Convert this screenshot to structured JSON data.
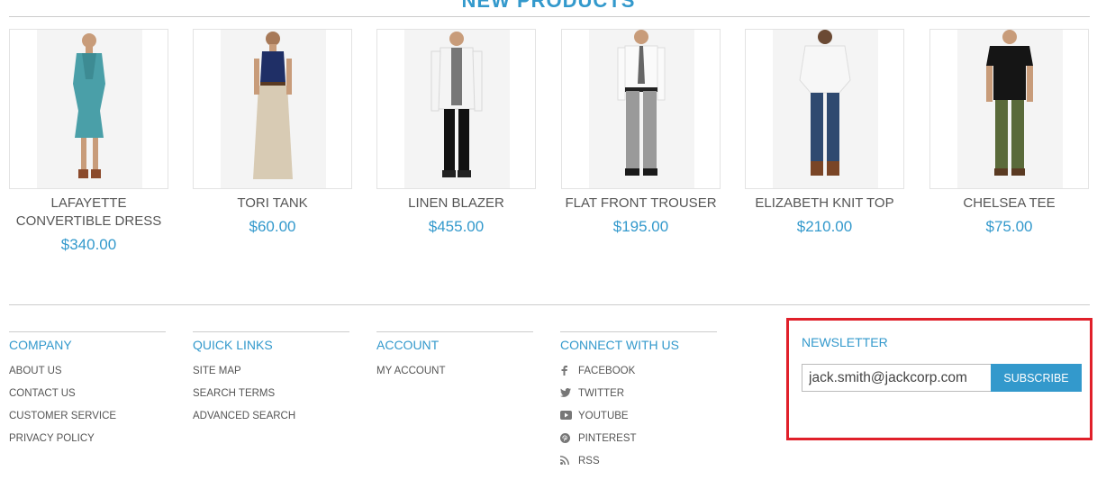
{
  "section": {
    "title": "NEW PRODUCTS"
  },
  "products": [
    {
      "name": "LAFAYETTE CONVERTIBLE DRESS",
      "price": "$340.00"
    },
    {
      "name": "TORI TANK",
      "price": "$60.00"
    },
    {
      "name": "LINEN BLAZER",
      "price": "$455.00"
    },
    {
      "name": "FLAT FRONT TROUSER",
      "price": "$195.00"
    },
    {
      "name": "ELIZABETH KNIT TOP",
      "price": "$210.00"
    },
    {
      "name": "CHELSEA TEE",
      "price": "$75.00"
    }
  ],
  "footer": {
    "company": {
      "title": "COMPANY",
      "links": [
        "ABOUT US",
        "CONTACT US",
        "CUSTOMER SERVICE",
        "PRIVACY POLICY"
      ]
    },
    "quick_links": {
      "title": "QUICK LINKS",
      "links": [
        "SITE MAP",
        "SEARCH TERMS",
        "ADVANCED SEARCH"
      ]
    },
    "account": {
      "title": "ACCOUNT",
      "links": [
        "MY ACCOUNT"
      ]
    },
    "connect": {
      "title": "CONNECT WITH US",
      "links": [
        {
          "label": "FACEBOOK",
          "icon": "facebook-icon"
        },
        {
          "label": "TWITTER",
          "icon": "twitter-icon"
        },
        {
          "label": "YOUTUBE",
          "icon": "youtube-icon"
        },
        {
          "label": "PINTEREST",
          "icon": "pinterest-icon"
        },
        {
          "label": "RSS",
          "icon": "rss-icon"
        }
      ]
    },
    "newsletter": {
      "title": "NEWSLETTER",
      "email_value": "jack.smith@jackcorp.com",
      "button_label": "SUBSCRIBE"
    }
  },
  "colors": {
    "accent": "#3399cc",
    "highlight": "#e0202a"
  }
}
